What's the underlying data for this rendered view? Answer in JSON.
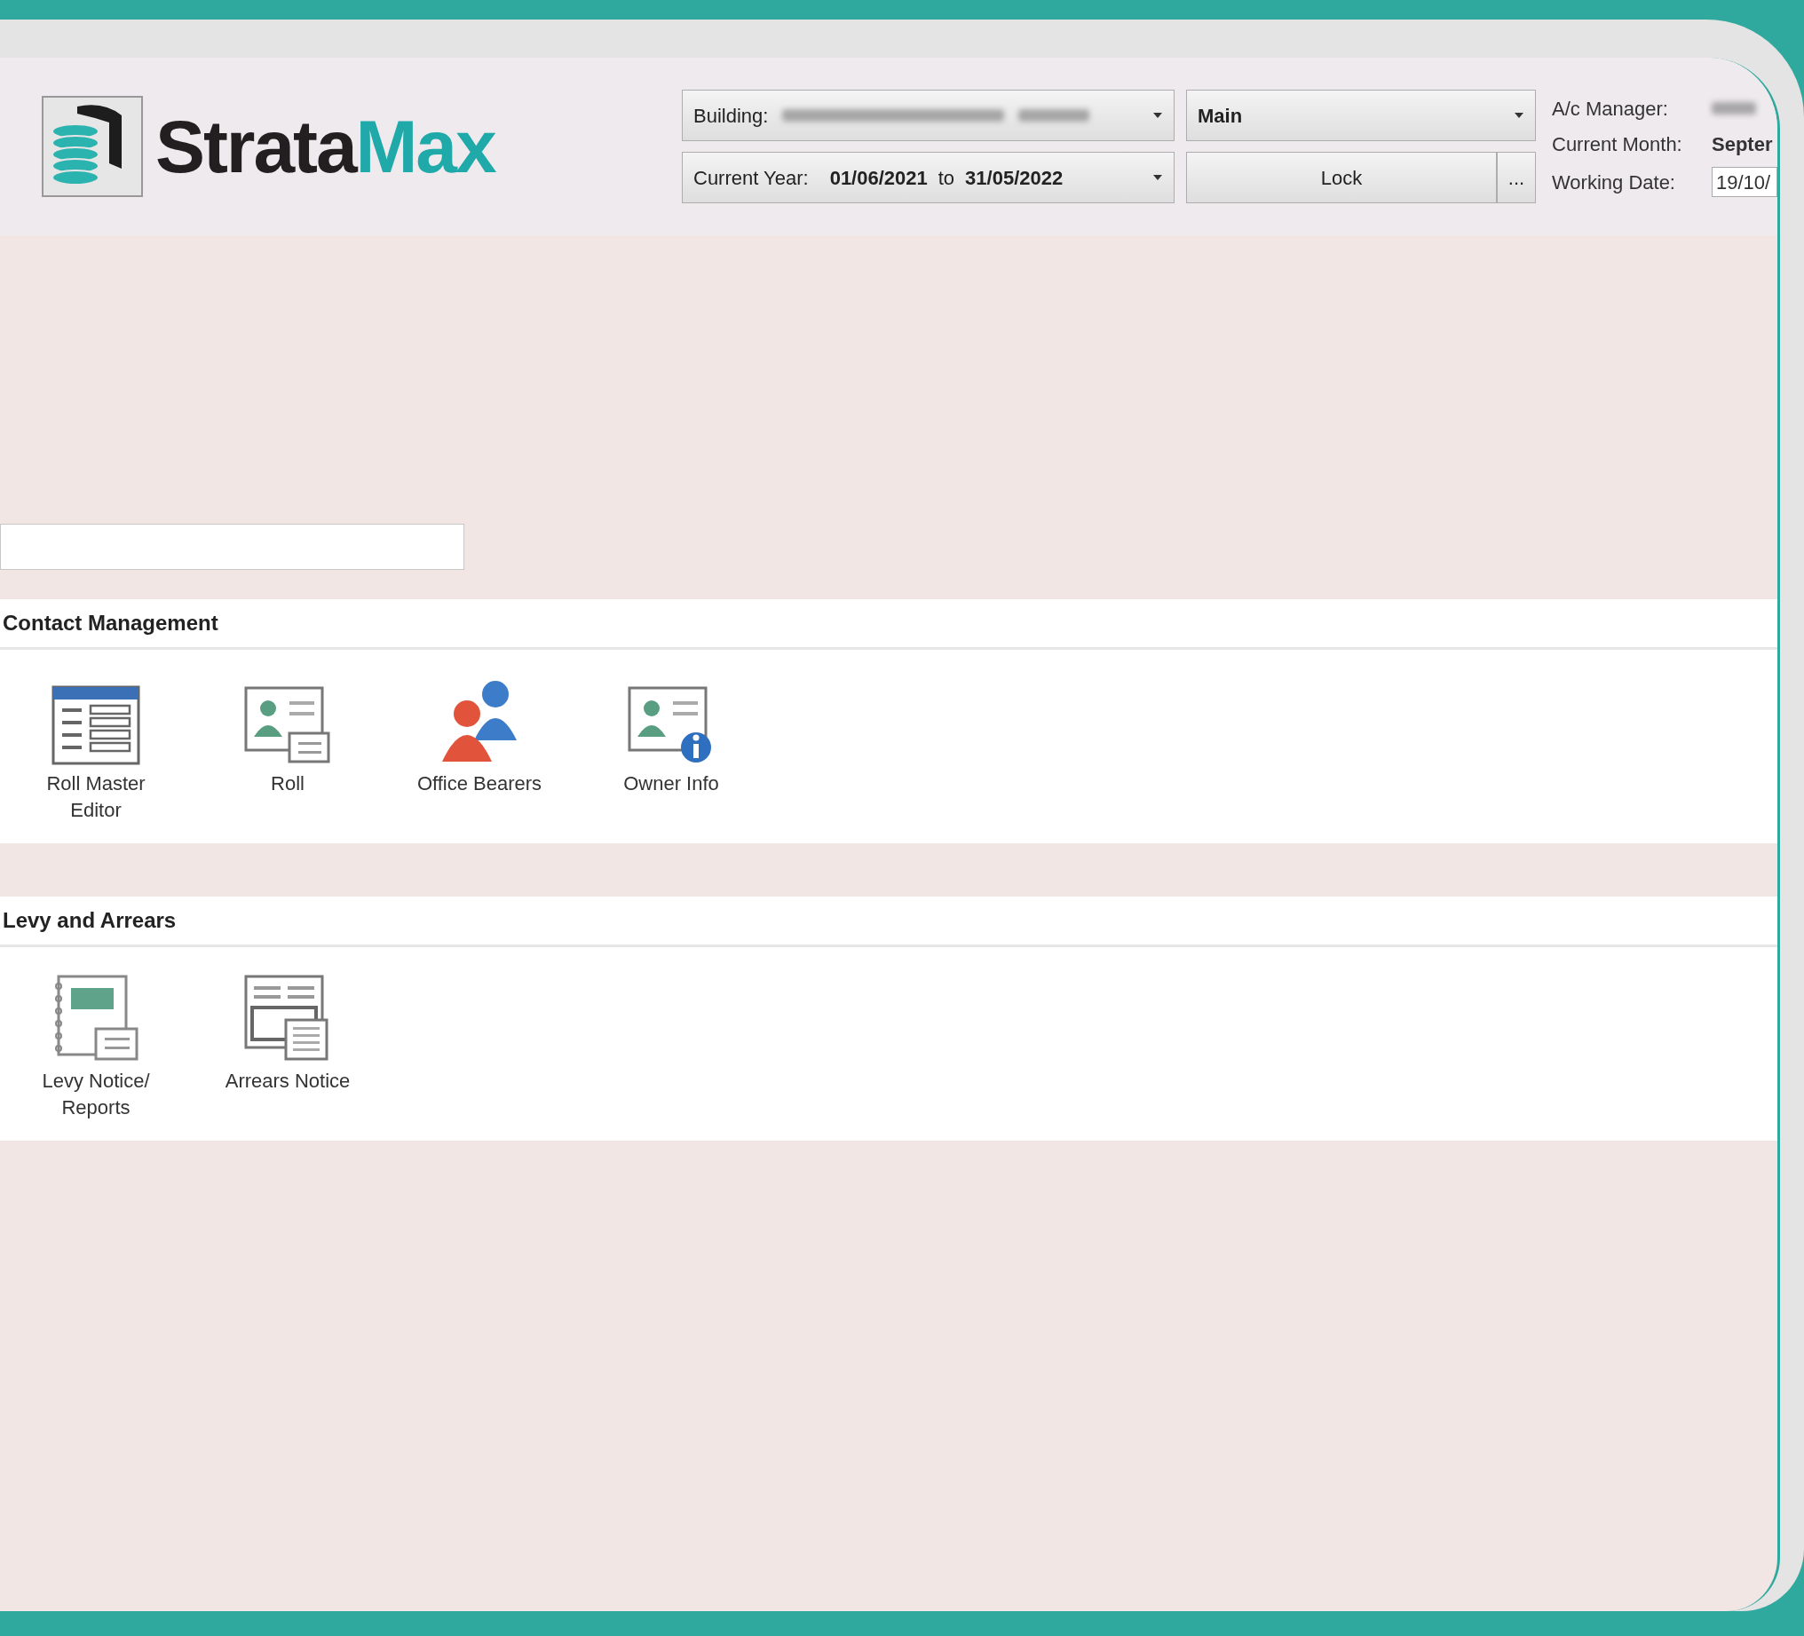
{
  "header": {
    "logo": {
      "text_dark": "Strata",
      "text_accent": "Max"
    },
    "building": {
      "label": "Building:"
    },
    "view": {
      "value": "Main"
    },
    "year": {
      "label": "Current Year:",
      "from": "01/06/2021",
      "to_word": "to",
      "to": "31/05/2022"
    },
    "lock_button": "Lock",
    "more_button": "...",
    "info": {
      "manager_label": "A/c Manager:",
      "month_label": "Current Month:",
      "month_value": "Septer",
      "working_date_label": "Working Date:",
      "working_date_value": "19/10/"
    }
  },
  "sections": [
    {
      "title": "Contact Management",
      "items": [
        {
          "label": "Roll Master Editor",
          "kind": "editor"
        },
        {
          "label": "Roll",
          "kind": "card"
        },
        {
          "label": "Office Bearers",
          "kind": "people"
        },
        {
          "label": "Owner Info",
          "kind": "info"
        }
      ]
    },
    {
      "title": "Levy and Arrears",
      "items": [
        {
          "label": "Levy Notice/ Reports",
          "kind": "notebook"
        },
        {
          "label": "Arrears Notice",
          "kind": "sheet"
        }
      ]
    }
  ]
}
